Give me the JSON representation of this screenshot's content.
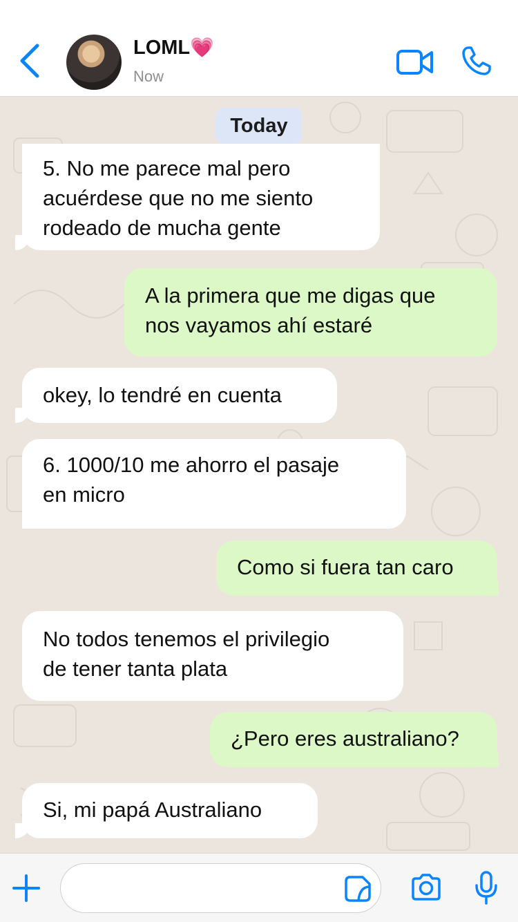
{
  "header": {
    "contact_name": "LOML",
    "contact_emoji": "💗",
    "status": "Now",
    "icons": [
      "chevron-left-icon",
      "video-call-icon",
      "phone-icon"
    ]
  },
  "chat": {
    "date_label": "Today",
    "messages": [
      {
        "dir": "in",
        "text": "5. No me parece mal pero\nacuérdese que no me siento\nrodeado de mucha gente"
      },
      {
        "dir": "out",
        "text": "A la primera que me digas que\nnos vayamos ahí estaré"
      },
      {
        "dir": "in",
        "text": "okey, lo tendré en cuenta"
      },
      {
        "dir": "in",
        "text": "6. 1000/10 me ahorro el pasaje\nen micro"
      },
      {
        "dir": "out",
        "text": "Como si fuera tan caro"
      },
      {
        "dir": "in",
        "text": "No todos tenemos el privilegio\nde tener tanta plata"
      },
      {
        "dir": "out",
        "text": "¿Pero eres australiano?"
      },
      {
        "dir": "in",
        "text": "Si, mi papá Australiano"
      }
    ]
  },
  "input_bar": {
    "placeholder": "",
    "icons": [
      "plus-icon",
      "sticker-icon",
      "camera-icon",
      "microphone-icon"
    ]
  },
  "colors": {
    "accent": "#0a84ff",
    "incoming_bubble": "#ffffff",
    "outgoing_bubble": "#dcf8c6",
    "chat_bg": "#ece5dd",
    "date_pill": "#dde6f7"
  }
}
